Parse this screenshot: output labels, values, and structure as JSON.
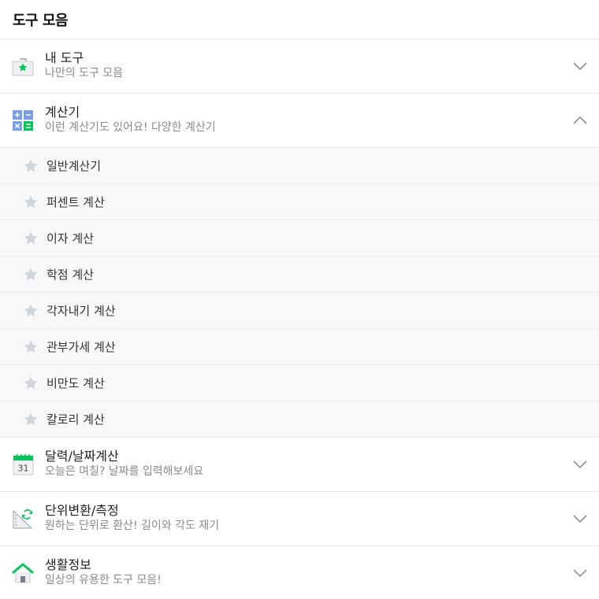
{
  "header": {
    "title": "도구 모음"
  },
  "sections": [
    {
      "title": "내 도구",
      "desc": "나만의 도구 모음",
      "icon": "my-tools-icon",
      "expanded": false
    },
    {
      "title": "계산기",
      "desc": "이런 계산기도 있어요! 다양한 계산기",
      "icon": "calculator-icon",
      "expanded": true
    },
    {
      "title": "달력/날짜계산",
      "desc": "오늘은 며칠? 날짜를 입력해보세요",
      "icon": "calendar-icon",
      "calendar_day": "31",
      "expanded": false
    },
    {
      "title": "단위변환/측정",
      "desc": "원하는 단위로 환산! 길이와 각도 재기",
      "icon": "unit-convert-icon",
      "expanded": false
    },
    {
      "title": "생활정보",
      "desc": "일상의 유용한 도구 모음!",
      "icon": "home-icon",
      "expanded": false
    }
  ],
  "calculator_items": [
    {
      "label": "일반계산기"
    },
    {
      "label": "퍼센트 계산"
    },
    {
      "label": "이자 계산"
    },
    {
      "label": "학점 계산"
    },
    {
      "label": "각자내기 계산"
    },
    {
      "label": "관부가세 계산"
    },
    {
      "label": "비만도 계산"
    },
    {
      "label": "칼로리 계산"
    }
  ],
  "colors": {
    "accent": "#03c75a",
    "calc_blue": "#7b9fe6",
    "star": "#d0d5da",
    "chevron": "#8e8e8e"
  }
}
